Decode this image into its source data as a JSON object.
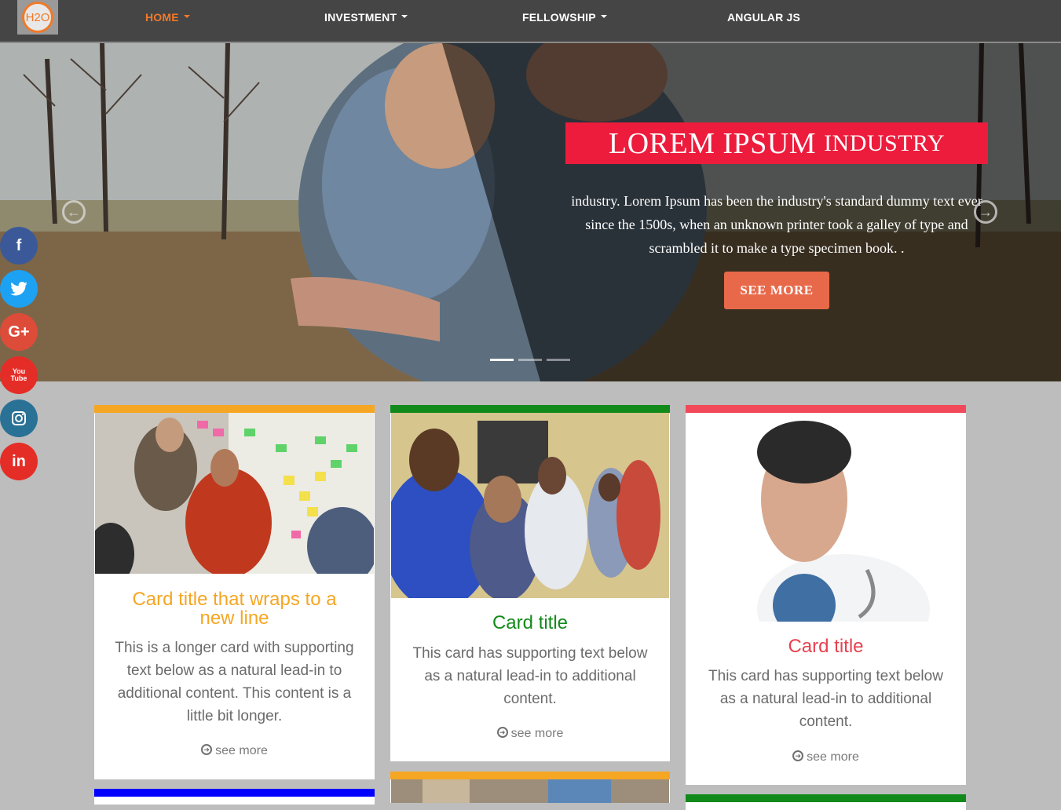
{
  "navbar": {
    "logo_text": "H2O",
    "items": [
      {
        "label": "HOME"
      },
      {
        "label": "INVESTMENT"
      },
      {
        "label": "FELLOWSHIP"
      },
      {
        "label": "ANGULAR JS"
      }
    ]
  },
  "hero": {
    "title_main": "LOREM IPSUM",
    "title_small": "INDUSTRY",
    "text": "industry. Lorem Ipsum has been the industry's standard dummy text ever since the 1500s, when an unknown printer took a galley of type and scrambled it to make a type specimen book. .",
    "button_label": "SEE MORE",
    "slides_total": 3,
    "active_slide": 1
  },
  "social": [
    {
      "name": "facebook",
      "glyph": "f",
      "color": "#3b5998"
    },
    {
      "name": "twitter",
      "glyph": "t",
      "color": "#1da1f2"
    },
    {
      "name": "google-plus",
      "glyph": "G+",
      "color": "#dd4b39"
    },
    {
      "name": "youtube",
      "glyph": "You Tube",
      "color": "#e52d27"
    },
    {
      "name": "instagram",
      "glyph": "◎",
      "color": "#2a7196"
    },
    {
      "name": "linkedin",
      "glyph": "in",
      "color": "#e52d27"
    }
  ],
  "cards": [
    {
      "title": "Card title that wraps to a new line",
      "text": "This is a longer card with supporting text below as a natural lead-in to additional content. This content is a little bit longer.",
      "link": "see more",
      "accent": "#f5a623",
      "title_color": "#f5a623"
    },
    {
      "title": "Card title",
      "text": "This card has supporting text below as a natural lead-in to additional content.",
      "link": "see more",
      "accent": "#128a1b",
      "title_color": "#128a1b"
    },
    {
      "title": "Card title",
      "text": "This card has supporting text below as a natural lead-in to additional content.",
      "link": "see more",
      "accent": "#f2495a",
      "title_color": "#e8404f"
    }
  ],
  "lower_card_accents": [
    "#0000ff",
    "#f5a623",
    "#128a1b"
  ]
}
